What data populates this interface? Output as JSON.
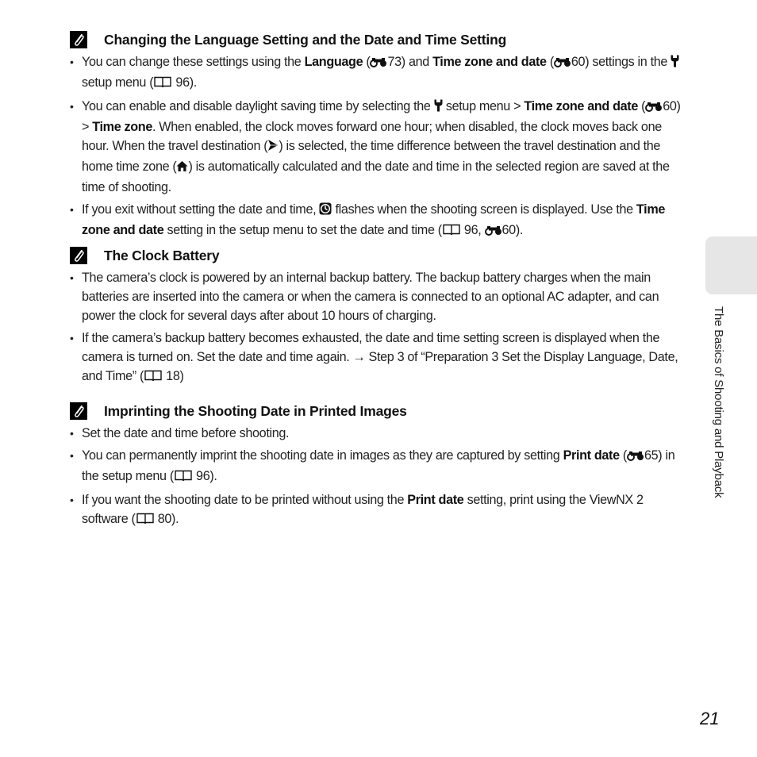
{
  "sections": [
    {
      "title": "Changing the Language Setting and the Date and Time Setting",
      "icon": "note-paperclip-icon",
      "bullets": [
        {
          "segments": [
            {
              "t": "You can change these settings using the "
            },
            {
              "t": "Language",
              "b": true
            },
            {
              "t": " ("
            },
            {
              "icon": "reference-binoculars-icon"
            },
            {
              "t": "73) and "
            },
            {
              "t": "Time zone and date",
              "b": true
            },
            {
              "t": " ("
            },
            {
              "icon": "reference-binoculars-icon"
            },
            {
              "t": "60) settings in the "
            },
            {
              "icon": "wrench-setup-icon"
            },
            {
              "t": " setup menu ("
            },
            {
              "icon": "book-page-icon"
            },
            {
              "t": " 96)."
            }
          ]
        },
        {
          "segments": [
            {
              "t": "You can enable and disable daylight saving time by selecting the "
            },
            {
              "icon": "wrench-setup-icon"
            },
            {
              "t": " setup menu > "
            },
            {
              "t": "Time zone and date",
              "b": true
            },
            {
              "t": " ("
            },
            {
              "icon": "reference-binoculars-icon"
            },
            {
              "t": "60) > "
            },
            {
              "t": "Time zone",
              "b": true
            },
            {
              "t": ". When enabled, the clock moves forward one hour; when disabled, the clock moves back one hour. When the travel destination ("
            },
            {
              "icon": "airplane-icon"
            },
            {
              "t": ") is selected, the time difference between the travel destination and the home time zone ("
            },
            {
              "icon": "home-icon"
            },
            {
              "t": ") is automatically calculated and the date and time in the selected region are saved at the time of shooting."
            }
          ]
        },
        {
          "segments": [
            {
              "t": "If you exit without setting the date and time, "
            },
            {
              "icon": "clock-not-set-icon"
            },
            {
              "t": " flashes when the shooting screen is displayed. Use the "
            },
            {
              "t": "Time zone and date",
              "b": true
            },
            {
              "t": " setting in the setup menu to set the date and time ("
            },
            {
              "icon": "book-page-icon"
            },
            {
              "t": " 96, "
            },
            {
              "icon": "reference-binoculars-icon"
            },
            {
              "t": "60)."
            }
          ]
        }
      ]
    },
    {
      "title": "The Clock Battery",
      "icon": "note-paperclip-icon",
      "bullets": [
        {
          "segments": [
            {
              "t": "The camera’s clock is powered by an internal backup battery. The backup battery charges when the main batteries are inserted into the camera or when the camera is connected to an optional AC adapter, and can power the clock for several days after about 10 hours of charging."
            }
          ]
        },
        {
          "segments": [
            {
              "t": "If the camera’s backup battery becomes exhausted, the date and time setting screen is displayed when the camera is turned on. Set the date and time again. → Step 3 of “Preparation 3 Set the Display Language, Date, and Time” ("
            },
            {
              "icon": "book-page-icon"
            },
            {
              "t": " 18)"
            }
          ]
        }
      ]
    },
    {
      "title": "Imprinting the Shooting Date in Printed Images",
      "icon": "note-paperclip-icon",
      "bullets": [
        {
          "segments": [
            {
              "t": "Set the date and time before shooting."
            }
          ]
        },
        {
          "segments": [
            {
              "t": "You can permanently imprint the shooting date in images as they are captured by setting "
            },
            {
              "t": "Print date",
              "b": true
            },
            {
              "t": " ("
            },
            {
              "icon": "reference-binoculars-icon"
            },
            {
              "t": "65) in the setup menu ("
            },
            {
              "icon": "book-page-icon"
            },
            {
              "t": " 96)."
            }
          ]
        },
        {
          "segments": [
            {
              "t": "If you want the shooting date to be printed without using the "
            },
            {
              "t": "Print date",
              "b": true
            },
            {
              "t": " setting, print using the ViewNX 2 software ("
            },
            {
              "icon": "book-page-icon"
            },
            {
              "t": " 80)."
            }
          ]
        }
      ]
    }
  ],
  "side_tab": {
    "label": "The Basics of Shooting and Playback",
    "color": "#e6e6e6"
  },
  "page_number": "21"
}
